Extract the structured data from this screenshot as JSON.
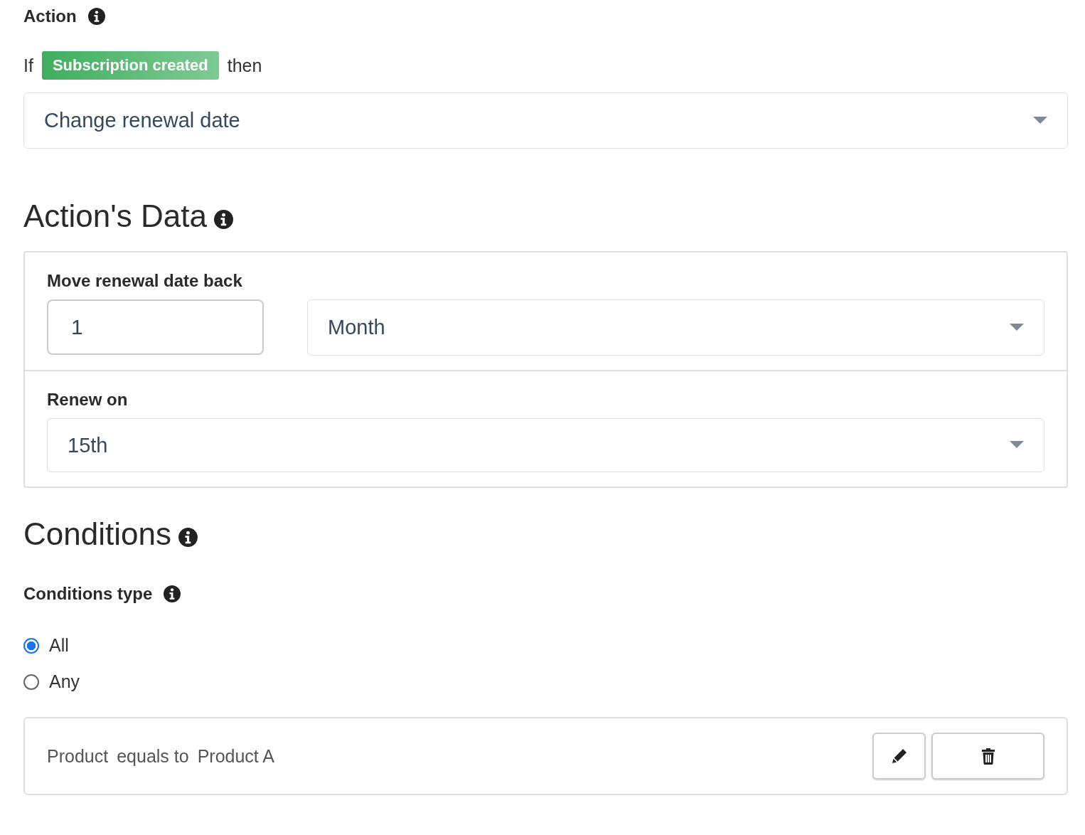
{
  "action": {
    "label": "Action",
    "if_text": "If",
    "trigger": "Subscription created",
    "then_text": "then",
    "select": {
      "value": "Change renewal date"
    }
  },
  "actions_data": {
    "heading": "Action's Data",
    "sections": [
      {
        "kind": "amount_unit",
        "label": "Move renewal date back",
        "amount": "1",
        "unit": "Month"
      },
      {
        "kind": "select",
        "label": "Renew on",
        "value": "15th"
      }
    ]
  },
  "conditions": {
    "heading": "Conditions",
    "type_label": "Conditions type",
    "options": [
      {
        "label": "All",
        "selected": true
      },
      {
        "label": "Any",
        "selected": false
      }
    ],
    "items": [
      {
        "field": "Product",
        "operator": "equals to",
        "value": "Product A"
      }
    ]
  }
}
